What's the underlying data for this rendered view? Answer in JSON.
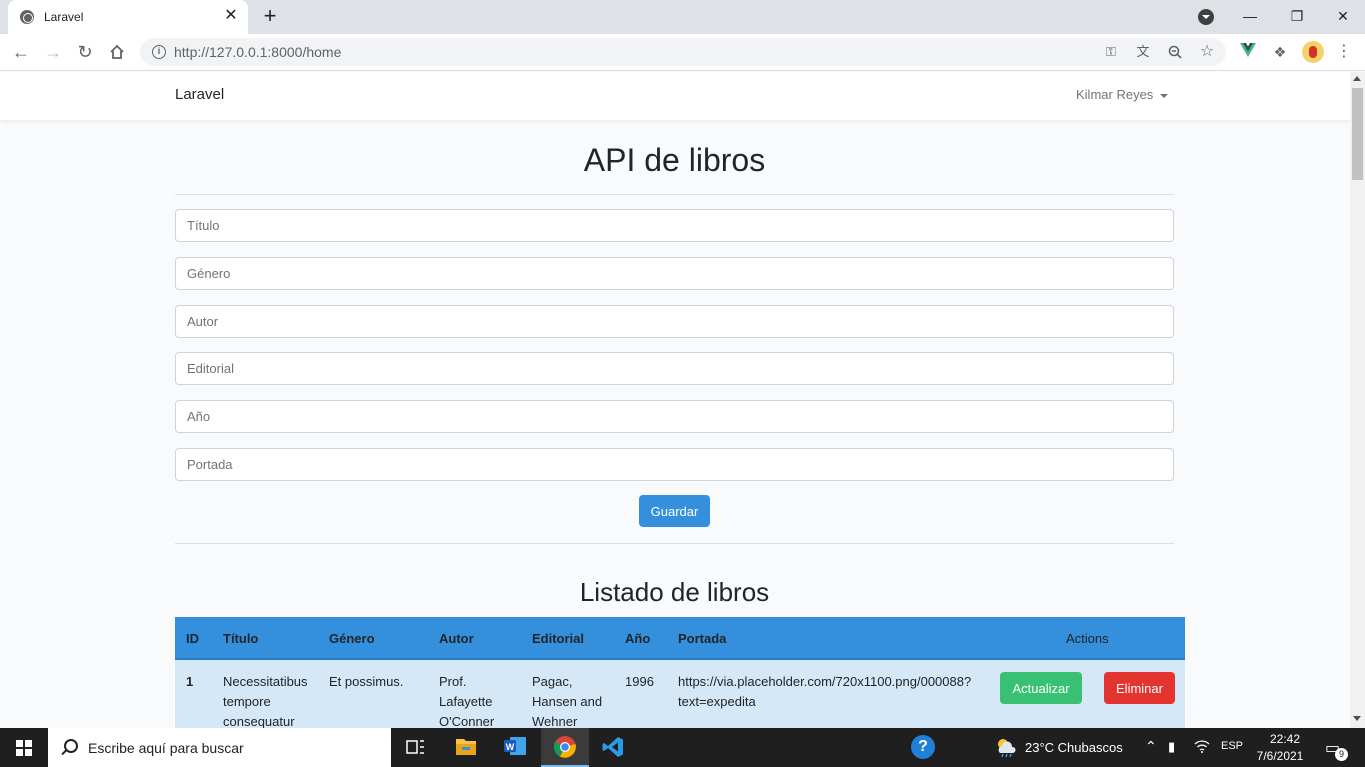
{
  "browser": {
    "tab_title": "Laravel",
    "tab_close": "✕",
    "new_tab": "+",
    "url": "http://127.0.0.1:8000/home",
    "window_controls": [
      "—",
      "❐",
      "✕"
    ],
    "icons": [
      "tab-search-icon",
      "info-icon",
      "key-icon",
      "translate-icon",
      "zoom-icon",
      "star-icon",
      "vue-devtools-icon",
      "extensions-icon",
      "profile-avatar",
      "menu-icon"
    ]
  },
  "navbar": {
    "brand": "Laravel",
    "user": "Kilmar Reyes"
  },
  "main": {
    "title": "API de libros",
    "fields": {
      "titulo": "Título",
      "genero": "Género",
      "autor": "Autor",
      "editorial": "Editorial",
      "anio": "Año",
      "portada": "Portada"
    },
    "save_label": "Guardar",
    "list_title": "Listado de libros"
  },
  "table": {
    "headers": [
      "ID",
      "Título",
      "Género",
      "Autor",
      "Editorial",
      "Año",
      "Portada",
      "Actions"
    ],
    "rows": [
      {
        "id": "1",
        "titulo": [
          "Necessitatibus",
          "tempore",
          "consequatur"
        ],
        "genero": "Et possimus.",
        "autor": [
          "Prof.",
          "Lafayette",
          "O'Conner"
        ],
        "editorial": [
          "Pagac,",
          "Hansen and",
          "Wehner"
        ],
        "anio": "1996",
        "portada": [
          "https://via.placeholder.com/720x1100.png/000088?",
          "text=expedita"
        ],
        "update_label": "Actualizar",
        "delete_label": "Eliminar"
      }
    ]
  },
  "taskbar": {
    "search_placeholder": "Escribe aquí para buscar",
    "weather": "23°C  Chubascos",
    "language": "ESP",
    "time": "22:42",
    "date": "7/6/2021",
    "notifications": "9"
  },
  "colors": {
    "primary": "#3490dc",
    "success": "#38c172",
    "danger": "#e3342f",
    "row_bg": "#d4e8f8"
  }
}
